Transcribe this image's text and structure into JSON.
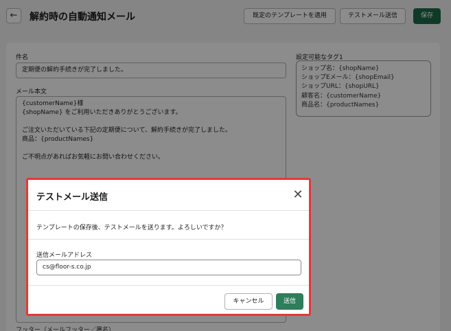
{
  "page": {
    "title": "解約時の自動通知メール",
    "back_icon": "←",
    "buttons": {
      "apply_template": "既定のテンプレートを適用",
      "send_test": "テストメール送信",
      "save": "保存"
    }
  },
  "form": {
    "subject_label": "件名",
    "subject_value": "定期便の解約手続きが完了しました。",
    "body_label": "メール本文",
    "body_lines": [
      "{customerName}様",
      "{shopName} をご利用いただきありがとうございます。",
      "",
      "ご注文いただいている下記の定期便について、解約手続きが完了しました。",
      "商品：{productNames}",
      "",
      "ご不明点があればお気軽にお問い合わせください。"
    ],
    "bottom_label_cut": "フッター（メールフッター／署名）"
  },
  "tags": {
    "label": "設定可能なタグ1",
    "items": [
      "ショップ名：{shopName}",
      "ショップEメール：{shopEmail}",
      "ショップURL：{shopURL}",
      "顧客名：{customerName}",
      "商品名：{productNames}"
    ]
  },
  "modal": {
    "title": "テストメール送信",
    "close_icon": "✕",
    "message": "テンプレートの保存後、テストメールを送ります。よろしいですか？",
    "email_label": "送信メールアドレス",
    "email_value": "cs@floor-s.co.jp",
    "cancel_label": "キャンセル",
    "send_label": "送信",
    "highlight_color": "#e53935"
  },
  "colors": {
    "primary": "#1e6b4a",
    "send_button": "#2e7d5b"
  }
}
